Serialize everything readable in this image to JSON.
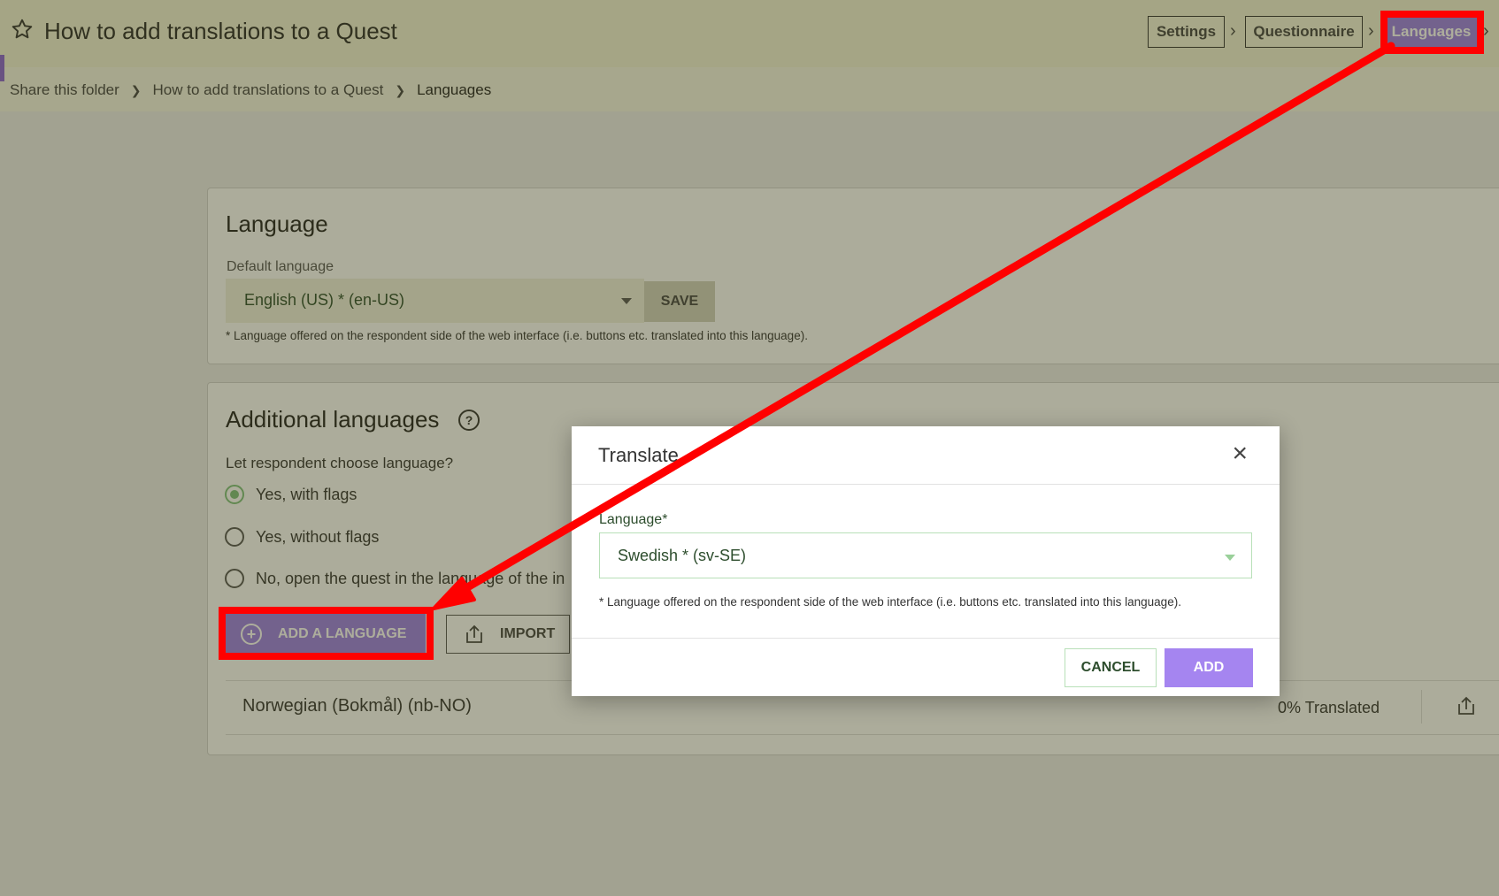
{
  "header": {
    "title": "How to add translations to a Quest",
    "steps": [
      {
        "label": "Settings"
      },
      {
        "label": "Questionnaire"
      },
      {
        "label": "Languages"
      }
    ]
  },
  "breadcrumb": {
    "items": [
      "Share this folder",
      "How to add translations to a Quest",
      "Languages"
    ]
  },
  "language_card": {
    "heading": "Language",
    "default_label": "Default language",
    "default_value": "English (US) * (en-US)",
    "save_label": "SAVE",
    "note": "* Language offered on the respondent side of the web interface (i.e. buttons etc. translated into this language)."
  },
  "additional_card": {
    "heading": "Additional languages",
    "question": "Let respondent choose language?",
    "options": [
      {
        "label": "Yes, with flags"
      },
      {
        "label": "Yes, without flags"
      },
      {
        "label": "No, open the quest in the language of the in"
      }
    ],
    "add_label": "ADD A LANGUAGE",
    "import_label": "IMPORT",
    "languages": [
      {
        "name": "Norwegian (Bokmål) (nb-NO)",
        "status": "0% Translated"
      }
    ]
  },
  "dialog": {
    "title": "Translate",
    "field_label": "Language*",
    "field_value": "Swedish * (sv-SE)",
    "note": "* Language offered on the respondent side of the web interface (i.e. buttons etc. translated into this language).",
    "cancel_label": "CANCEL",
    "add_label": "ADD"
  },
  "icons": {
    "favorite": "star-icon",
    "help": "question-circle-icon",
    "add": "plus-circle-icon",
    "import": "upload-icon",
    "close": "close-icon"
  },
  "colors": {
    "accent": "#9b7fe6",
    "annotation": "#ff0000",
    "success": "#7fc07f"
  }
}
